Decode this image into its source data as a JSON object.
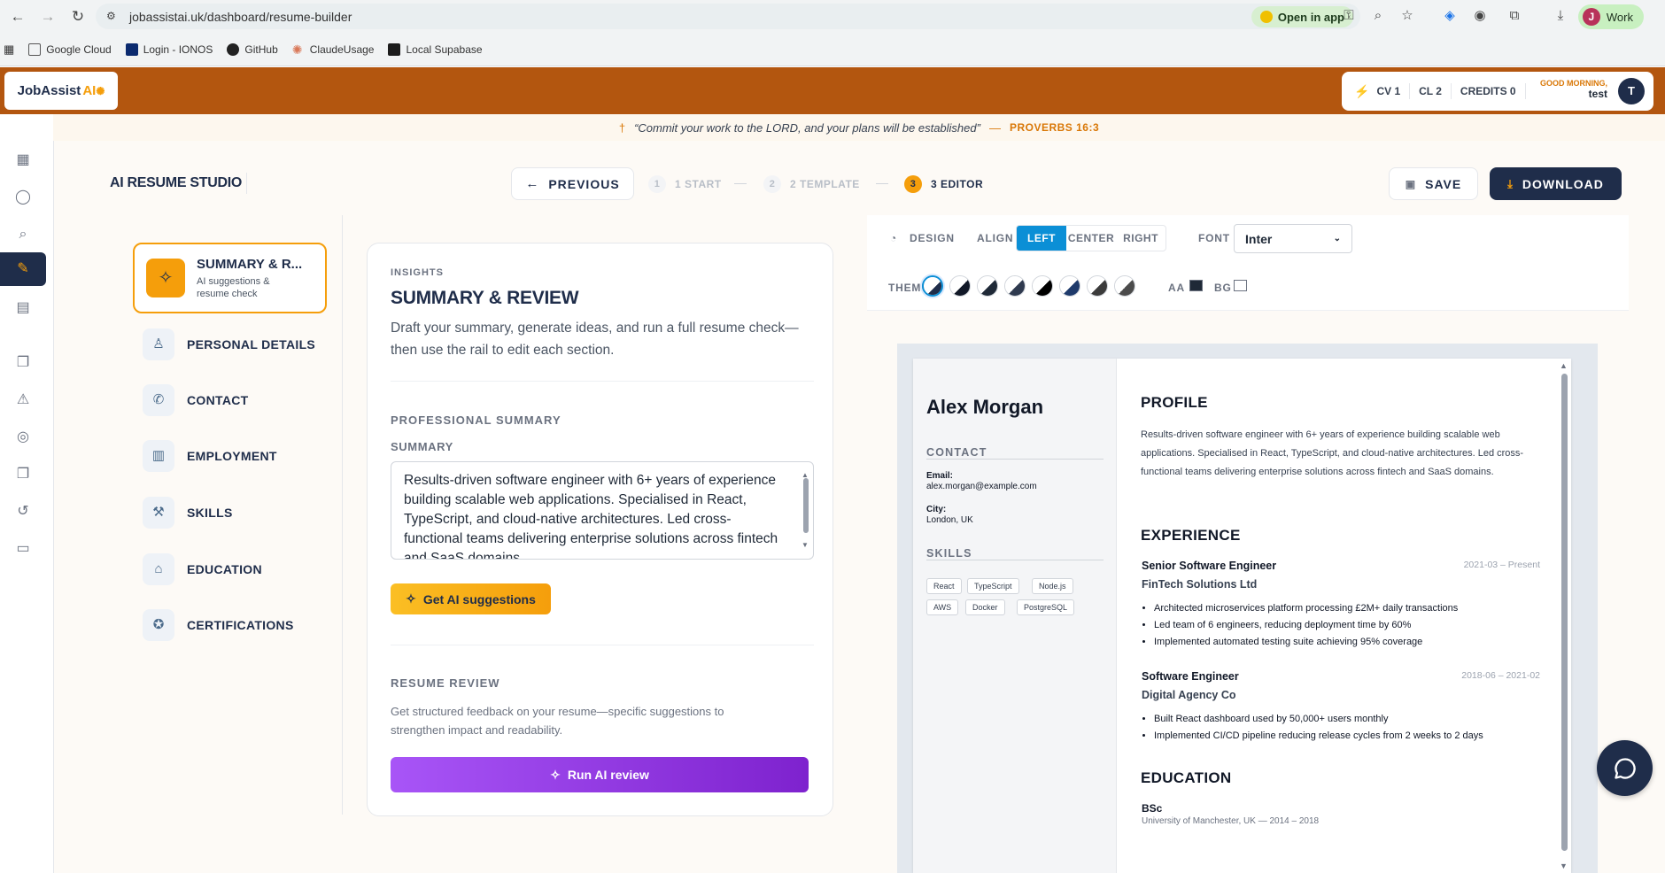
{
  "browser": {
    "url": "jobassistai.uk/dashboard/resume-builder",
    "open_in_app": "Open in app",
    "profile_initial": "J",
    "profile_label": "Work",
    "bookmarks": [
      {
        "label": "Google Cloud",
        "icon": "folder-icon"
      },
      {
        "label": "Login - IONOS",
        "icon": "ionos-icon"
      },
      {
        "label": "GitHub",
        "icon": "github-icon"
      },
      {
        "label": "ClaudeUsage",
        "icon": "claude-icon"
      },
      {
        "label": "Local Supabase",
        "icon": "supabase-icon"
      }
    ]
  },
  "header": {
    "logo_text": "JobAssist",
    "logo_ai": "AI",
    "cv": "CV 1",
    "cl": "CL 2",
    "credits": "CREDITS 0",
    "greeting": "GOOD MORNING,",
    "username": "test",
    "avatar_initial": "T"
  },
  "verse": {
    "text": "“Commit your work to the LORD, and your plans will be established”",
    "dash": "—",
    "ref": "PROVERBS 16:3"
  },
  "toolbar": {
    "title": "AI RESUME STUDIO",
    "previous": "PREVIOUS",
    "steps": [
      {
        "num": "1",
        "label": "1 START"
      },
      {
        "num": "2",
        "label": "2 TEMPLATE"
      },
      {
        "num": "3",
        "label": "3 EDITOR"
      }
    ],
    "save": "SAVE",
    "download": "DOWNLOAD"
  },
  "sections": {
    "active": {
      "title": "SUMMARY & R...",
      "subtitle": "AI suggestions & resume check"
    },
    "items": [
      {
        "label": "PERSONAL DETAILS",
        "icon": "user-icon"
      },
      {
        "label": "CONTACT",
        "icon": "phone-icon"
      },
      {
        "label": "EMPLOYMENT",
        "icon": "briefcase-icon"
      },
      {
        "label": "SKILLS",
        "icon": "wrench-icon"
      },
      {
        "label": "EDUCATION",
        "icon": "graduation-cap-icon"
      },
      {
        "label": "CERTIFICATIONS",
        "icon": "award-icon"
      }
    ]
  },
  "insights": {
    "eyebrow": "INSIGHTS",
    "heading": "SUMMARY & REVIEW",
    "description": "Draft your summary, generate ideas, and run a full resume check—then use the rail to edit each section.",
    "professional_summary": "PROFESSIONAL SUMMARY",
    "summary_label": "SUMMARY",
    "summary_value": "Results-driven software engineer with 6+ years of experience building scalable web applications. Specialised in React, TypeScript, and cloud-native architectures. Led cross-functional teams delivering enterprise solutions across fintech and SaaS domains.",
    "get_ai": "Get AI suggestions",
    "resume_review": "RESUME REVIEW",
    "review_desc": "Get structured feedback on your resume—specific suggestions to strengthen impact and readability.",
    "run_review": "Run AI review"
  },
  "design": {
    "design_label": "DESIGN",
    "align_label": "ALIGN",
    "align_options": [
      "LEFT",
      "CENTER",
      "RIGHT"
    ],
    "align_selected": "LEFT",
    "font_label": "FONT",
    "font_value": "Inter",
    "theme_label": "THEME",
    "themes": [
      "#1f2d4a",
      "#111827",
      "#1f2937",
      "#2f3a4f",
      "#000000",
      "#1e3a6b",
      "#3b3b3b",
      "#4b4b4b"
    ],
    "aa_label": "AA",
    "aa_color": "#1f2937",
    "bg_label": "BG",
    "bg_color": "#ffffff"
  },
  "resume": {
    "name": "Alex Morgan",
    "contact_heading": "CONTACT",
    "email_label": "Email:",
    "email": "alex.morgan@example.com",
    "city_label": "City:",
    "city": "London, UK",
    "skills_heading": "SKILLS",
    "skills": [
      "React",
      "TypeScript",
      "Node.js",
      "AWS",
      "Docker",
      "PostgreSQL"
    ],
    "profile_heading": "PROFILE",
    "profile": "Results-driven software engineer with 6+ years of experience building scalable web applications. Specialised in React, TypeScript, and cloud-native architectures. Led cross-functional teams delivering enterprise solutions across fintech and SaaS domains.",
    "experience_heading": "EXPERIENCE",
    "jobs": [
      {
        "title": "Senior Software Engineer",
        "company": "FinTech Solutions Ltd",
        "dates": "2021-03 – Present",
        "bullets": [
          "Architected microservices platform processing £2M+ daily transactions",
          "Led team of 6 engineers, reducing deployment time by 60%",
          "Implemented automated testing suite achieving 95% coverage"
        ]
      },
      {
        "title": "Software Engineer",
        "company": "Digital Agency Co",
        "dates": "2018-06 – 2021-02",
        "bullets": [
          "Built React dashboard used by 50,000+ users monthly",
          "Implemented CI/CD pipeline reducing release cycles from 2 weeks to 2 days"
        ]
      }
    ],
    "education_heading": "EDUCATION",
    "degree": "BSc",
    "school": "University of Manchester, UK — 2014 – 2018"
  }
}
